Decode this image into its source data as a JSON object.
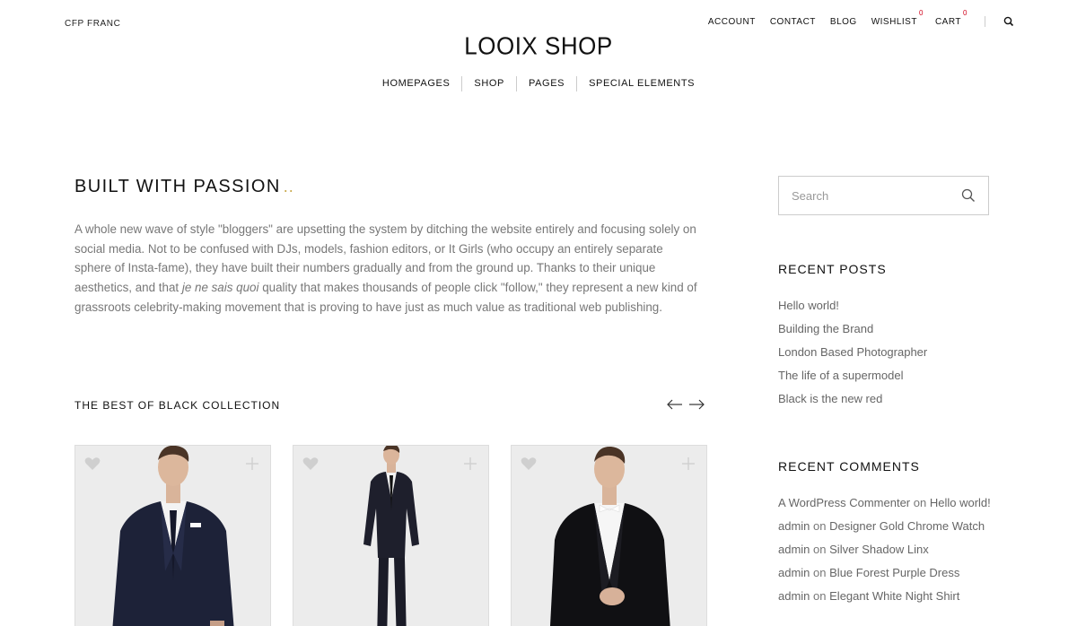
{
  "header": {
    "currency": "CFP FRANC",
    "logo": "LOOIX SHOP",
    "top_nav": [
      {
        "label": "ACCOUNT"
      },
      {
        "label": "CONTACT"
      },
      {
        "label": "BLOG"
      },
      {
        "label": "WISHLIST",
        "count": "0"
      },
      {
        "label": "CART",
        "count": "0"
      }
    ],
    "search_icon": "search-icon",
    "main_nav": [
      "HOMEPAGES",
      "SHOP",
      "PAGES",
      "SPECIAL ELEMENTS"
    ]
  },
  "content": {
    "headline": "BUILT WITH PASSION",
    "headline_dots": "..",
    "accent_color": "#c9a94d",
    "intro_before": "A whole new wave of style \"bloggers\" are upsetting the system by ditching the website entirely and focusing solely on social media. Not to be confused with DJs, models, fashion editors, or It Girls (who occupy an entirely separate sphere of Insta-fame), they have built their numbers gradually and from the ground up. Thanks to their unique aesthetics, and that ",
    "intro_italic": "je ne sais quoi",
    "intro_after": " quality that makes thousands of people click \"follow,\" they represent a new kind of grassroots celebrity-making movement that is proving to have just as much value as traditional web publishing.",
    "collection_title": "THE BEST OF BLACK COLLECTION",
    "arrows": [
      "arrow-left-icon",
      "arrow-right-icon"
    ],
    "products": [
      {
        "icon_fav": "heart-icon",
        "icon_add": "plus-icon"
      },
      {
        "icon_fav": "heart-icon",
        "icon_add": "plus-icon"
      },
      {
        "icon_fav": "heart-icon",
        "icon_add": "plus-icon"
      }
    ]
  },
  "sidebar": {
    "search_placeholder": "Search",
    "recent_posts_title": "RECENT POSTS",
    "recent_posts": [
      "Hello world!",
      "Building the Brand",
      "London Based Photographer",
      "The life of a supermodel",
      "Black is the new red"
    ],
    "recent_comments_title": "RECENT COMMENTS",
    "recent_comments": [
      {
        "author": "A WordPress Commenter",
        "on": "on",
        "post": "Hello world!"
      },
      {
        "author": "admin",
        "on": "on",
        "post": "Designer Gold Chrome Watch"
      },
      {
        "author": "admin",
        "on": "on",
        "post": "Silver Shadow Linx"
      },
      {
        "author": "admin",
        "on": "on",
        "post": "Blue Forest Purple Dress"
      },
      {
        "author": "admin",
        "on": "on",
        "post": "Elegant White Night Shirt"
      }
    ]
  }
}
